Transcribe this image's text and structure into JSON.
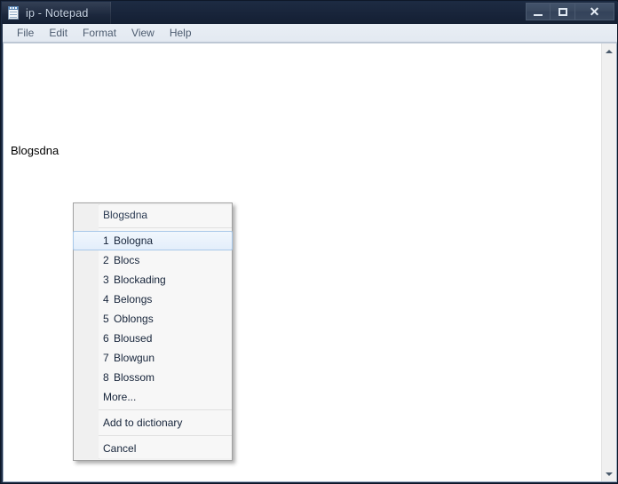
{
  "window": {
    "title": "ip - Notepad",
    "icon": "notepad-icon",
    "controls": {
      "minimize": "—",
      "maximize": "□",
      "close": "✕"
    }
  },
  "menubar": {
    "items": [
      {
        "label": "File"
      },
      {
        "label": "Edit"
      },
      {
        "label": "Format"
      },
      {
        "label": "View"
      },
      {
        "label": "Help"
      }
    ]
  },
  "document": {
    "text": "Blogsdna"
  },
  "scrollbar": {
    "up_arrow": "scroll-up-icon",
    "down_arrow": "scroll-down-icon"
  },
  "context_menu": {
    "header": "Blogsdna",
    "suggestions": [
      {
        "num": "1",
        "label": "Bologna",
        "selected": true
      },
      {
        "num": "2",
        "label": "Blocs",
        "selected": false
      },
      {
        "num": "3",
        "label": "Blockading",
        "selected": false
      },
      {
        "num": "4",
        "label": "Belongs",
        "selected": false
      },
      {
        "num": "5",
        "label": "Oblongs",
        "selected": false
      },
      {
        "num": "6",
        "label": "Bloused",
        "selected": false
      },
      {
        "num": "7",
        "label": "Blowgun",
        "selected": false
      },
      {
        "num": "8",
        "label": "Blossom",
        "selected": false
      }
    ],
    "more": "More...",
    "add_to_dictionary": "Add to dictionary",
    "cancel": "Cancel"
  },
  "colors": {
    "titlebar": "#18243a",
    "titlebar_text": "#c8d4e4",
    "menubar_bg": "#e6ecf3",
    "menu_bg": "#f7f7f7",
    "menu_gutter": "#f0f0f0",
    "selection_border": "#a8c8e8",
    "selection_fill": "#e3eefb",
    "text": "#16243a"
  }
}
